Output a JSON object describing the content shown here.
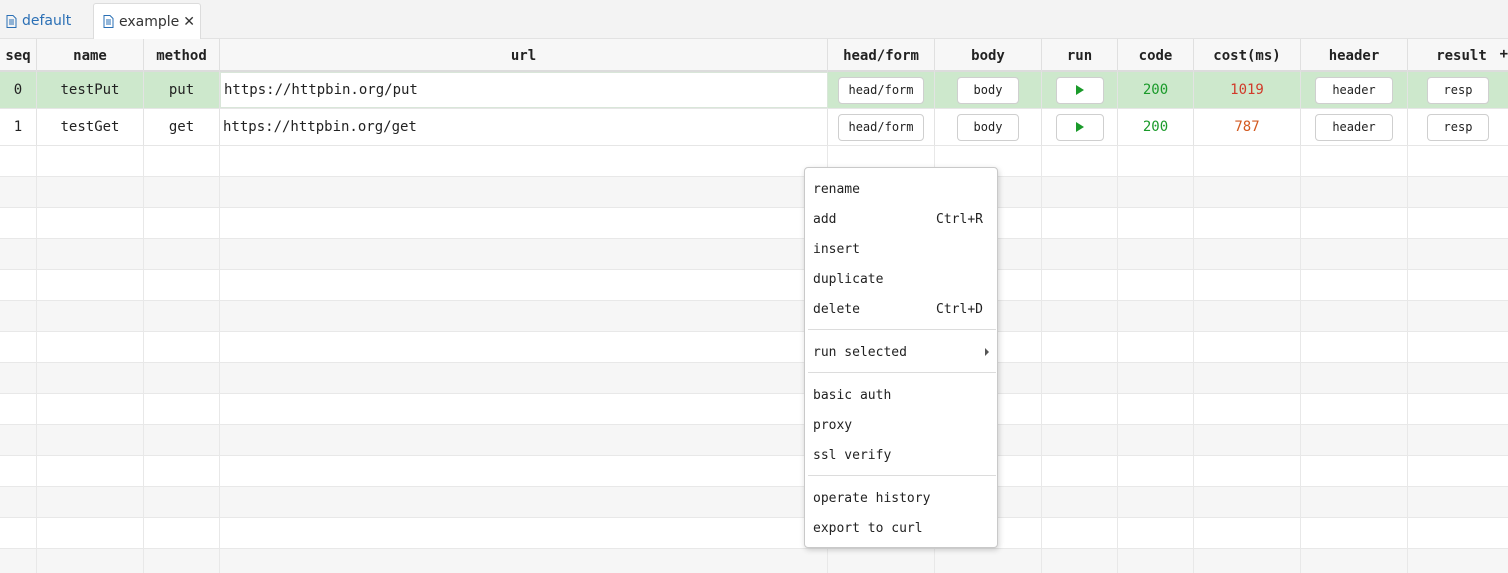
{
  "tabs": [
    {
      "label": "default",
      "active": false
    },
    {
      "label": "example",
      "active": true
    }
  ],
  "close_glyph": "✕",
  "columns": [
    "seq",
    "name",
    "method",
    "url",
    "head/form",
    "body",
    "run",
    "code",
    "cost(ms)",
    "header",
    "result"
  ],
  "add_column_glyph": "+",
  "rows": [
    {
      "seq": "0",
      "name": "testPut",
      "method": "put",
      "url": "https://httpbin.org/put",
      "head_form": "head/form",
      "body": "body",
      "code": "200",
      "cost": "1019",
      "header": "header",
      "result": "resp"
    },
    {
      "seq": "1",
      "name": "testGet",
      "method": "get",
      "url": "https://httpbin.org/get",
      "head_form": "head/form",
      "body": "body",
      "code": "200",
      "cost": "787",
      "header": "header",
      "result": "resp"
    }
  ],
  "context_menu": {
    "items": [
      {
        "label": "rename",
        "shortcut": ""
      },
      {
        "label": "add",
        "shortcut": "Ctrl+R"
      },
      {
        "label": "insert",
        "shortcut": ""
      },
      {
        "label": "duplicate",
        "shortcut": ""
      },
      {
        "label": "delete",
        "shortcut": "Ctrl+D"
      },
      {
        "label": "run selected",
        "shortcut": "",
        "submenu": true
      },
      {
        "label": "basic auth",
        "shortcut": ""
      },
      {
        "label": "proxy",
        "shortcut": ""
      },
      {
        "label": "ssl verify",
        "shortcut": ""
      },
      {
        "label": "operate history",
        "shortcut": ""
      },
      {
        "label": "export to curl",
        "shortcut": ""
      }
    ]
  },
  "colors": {
    "selected_row": "#cde8cc",
    "success": "#1a9a2a",
    "cost_slow": "#d13a2a",
    "cost_ok": "#d35a20",
    "link": "#2a6fb5"
  },
  "icons": {
    "tab_icon": "document-icon",
    "run_icon": "play-icon"
  }
}
